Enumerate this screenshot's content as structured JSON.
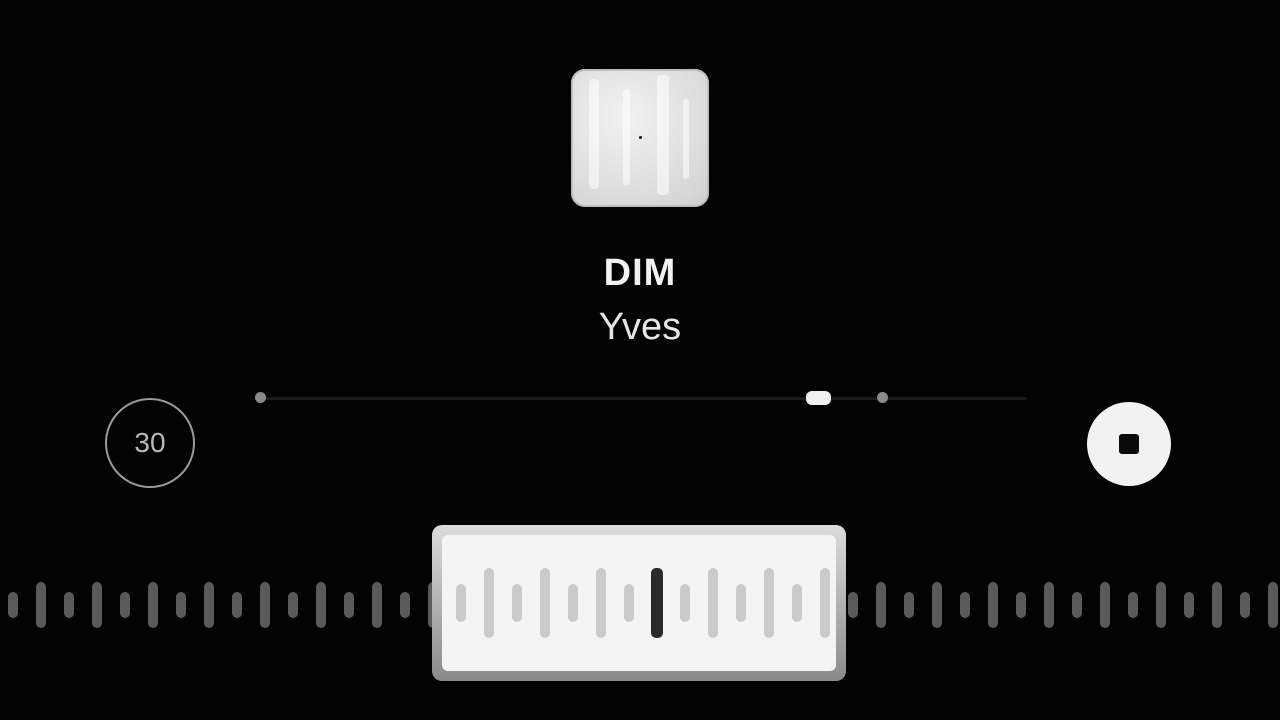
{
  "track": {
    "title": "DIM",
    "artist": "Yves"
  },
  "controls": {
    "skip_label": "30",
    "skip_icon": "skip-30-icon",
    "stop_icon": "stop-icon"
  },
  "progress": {
    "played_fraction": 0.727,
    "marker_fraction": 0.811
  },
  "colors": {
    "background": "#030303",
    "foreground": "#f2f2f2",
    "waveform": "#5a5a5a"
  }
}
